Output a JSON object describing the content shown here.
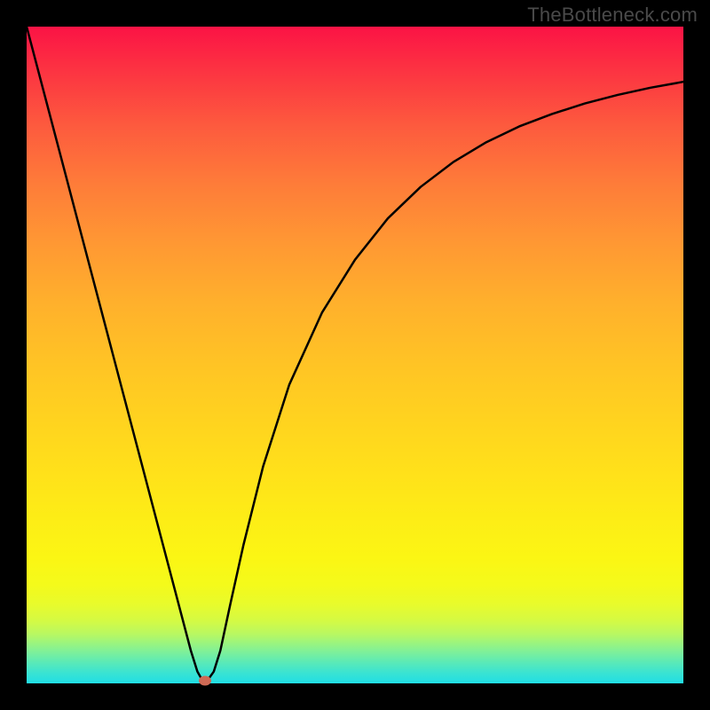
{
  "watermark": "TheBottleneck.com",
  "chart_data": {
    "type": "line",
    "title": "",
    "xlabel": "",
    "ylabel": "",
    "xlim": [
      0,
      1
    ],
    "ylim": [
      0,
      1
    ],
    "x": [
      0.0,
      0.025,
      0.05,
      0.075,
      0.1,
      0.125,
      0.15,
      0.175,
      0.2,
      0.225,
      0.25,
      0.26,
      0.268,
      0.275,
      0.285,
      0.295,
      0.31,
      0.33,
      0.36,
      0.4,
      0.45,
      0.5,
      0.55,
      0.6,
      0.65,
      0.7,
      0.75,
      0.8,
      0.85,
      0.9,
      0.95,
      1.0
    ],
    "y": [
      1.0,
      0.905,
      0.81,
      0.715,
      0.62,
      0.525,
      0.43,
      0.335,
      0.24,
      0.145,
      0.05,
      0.018,
      0.004,
      0.004,
      0.018,
      0.05,
      0.12,
      0.21,
      0.33,
      0.455,
      0.565,
      0.645,
      0.708,
      0.756,
      0.794,
      0.824,
      0.848,
      0.867,
      0.883,
      0.896,
      0.907,
      0.916
    ],
    "marker": {
      "x": 0.272,
      "y": 0.0
    },
    "background_gradient": {
      "top": "#fb1345",
      "mid": "#ffe11a",
      "bottom": "#21dee5"
    }
  }
}
